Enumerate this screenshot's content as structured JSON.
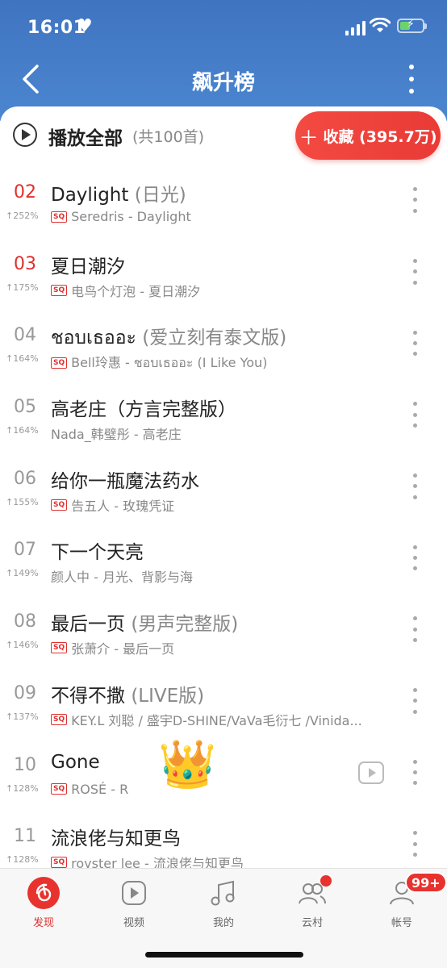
{
  "status_bar": {
    "time": "16:01"
  },
  "navbar": {
    "title": "飙升榜"
  },
  "toolbar": {
    "play_all_label": "播放全部",
    "count_label": "(共100首)",
    "collect_label": "收藏 (395.7万)"
  },
  "songs": [
    {
      "rank": "02",
      "top": true,
      "trend": "252%",
      "title": "Daylight",
      "subtitle": "(日光)",
      "sq": true,
      "meta": "Seredris - Daylight"
    },
    {
      "rank": "03",
      "top": true,
      "trend": "175%",
      "title": "夏日潮汐",
      "subtitle": "",
      "sq": true,
      "meta": "电鸟个灯泡 - 夏日潮汐"
    },
    {
      "rank": "04",
      "top": false,
      "trend": "164%",
      "title": "ชอบเธออะ",
      "subtitle": "(爱立刻有泰文版)",
      "sq": true,
      "meta": "Bell玲惠 - ชอบเธออะ (I Like You)"
    },
    {
      "rank": "05",
      "top": false,
      "trend": "164%",
      "title": "高老庄（方言完整版）",
      "subtitle": "",
      "sq": false,
      "meta": "Nada_韩璧彤 - 高老庄"
    },
    {
      "rank": "06",
      "top": false,
      "trend": "155%",
      "title": "给你一瓶魔法药水",
      "subtitle": "",
      "sq": true,
      "meta": "告五人 - 玫瑰凭证"
    },
    {
      "rank": "07",
      "top": false,
      "trend": "149%",
      "title": "下一个天亮",
      "subtitle": "",
      "sq": false,
      "meta": "颜人中 - 月光、背影与海"
    },
    {
      "rank": "08",
      "top": false,
      "trend": "146%",
      "title": "最后一页",
      "subtitle": "(男声完整版)",
      "sq": true,
      "meta": "张萧介 - 最后一页"
    },
    {
      "rank": "09",
      "top": false,
      "trend": "137%",
      "title": "不得不撒",
      "subtitle": "(LIVE版)",
      "sq": true,
      "meta": "KEY.L 刘聪 / 盛宇D-SHINE/VaVa毛衍七 /Vinida..."
    },
    {
      "rank": "10",
      "top": false,
      "trend": "128%",
      "title": "Gone",
      "subtitle": "",
      "sq": true,
      "meta": "ROSÉ - R"
    },
    {
      "rank": "11",
      "top": false,
      "trend": "128%",
      "title": "流浪佬与知更鸟",
      "subtitle": "",
      "sq": true,
      "meta": "royster lee - 流浪佬与知更鸟"
    }
  ],
  "sq_label": "SQ",
  "sticker": "👑",
  "tabbar": {
    "tabs": [
      {
        "label": "发现",
        "active": true
      },
      {
        "label": "视频",
        "active": false
      },
      {
        "label": "我的",
        "active": false
      },
      {
        "label": "云村",
        "active": false
      },
      {
        "label": "帐号",
        "active": false
      }
    ],
    "account_badge": "99+"
  },
  "colors": {
    "accent": "#e8322e",
    "header": "#4c86d0"
  }
}
